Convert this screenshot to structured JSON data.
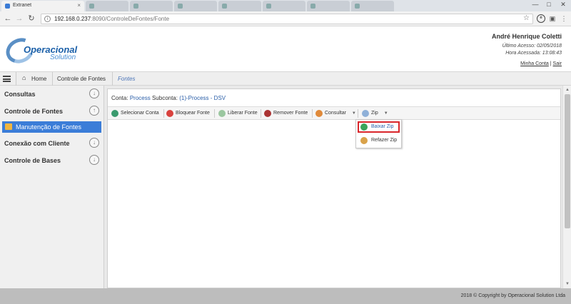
{
  "browser": {
    "active_tab_title": "Extranet",
    "url_host": "192.168.0.237",
    "url_path": ":8090/ControleDeFontes/Fonte",
    "window_controls": [
      "—",
      "□",
      "✕"
    ]
  },
  "header": {
    "logo_main": "Operacional",
    "logo_sub": "Solution",
    "user_name": "André Henrique Coletti",
    "last_access": "Último Acesso: 02/05/2018",
    "access_time": "Hora Acessada: 13:08:43",
    "my_account": "Minha Conta",
    "link_separator": "|",
    "logout": "Sair"
  },
  "breadcrumb": {
    "home": "Home",
    "section": "Controle de Fontes",
    "current": "Fontes"
  },
  "sidebar": {
    "items": [
      {
        "label": "Consultas",
        "toggle": "↓"
      },
      {
        "label": "Controle de Fontes",
        "toggle": "↑"
      },
      {
        "label": "Conexão com Cliente",
        "toggle": "↓"
      },
      {
        "label": "Controle de Bases",
        "toggle": "↓"
      }
    ],
    "sub_item": "Manutenção de Fontes"
  },
  "main": {
    "account_label": "Conta:",
    "account_value": "Process",
    "subaccount_label": "Subconta:",
    "subaccount_value": "(1)-Process - DSV",
    "buttons": {
      "select_account": "Selecionar Conta",
      "block_source": "Bloquear Fonte",
      "release_source": "Liberar Fonte",
      "remove_source": "Remover Fonte",
      "consult": "Consultar",
      "zip": "Zip"
    },
    "zip_menu": {
      "download": "Baixar Zip",
      "redo": "Refazer Zip"
    }
  },
  "footer": {
    "copyright": "2018 © Copyright by Operacional Solution Ltda"
  },
  "colors": {
    "accent_blue": "#3b7dd8",
    "link_blue": "#2a5ea8",
    "highlight_red": "#d9262b"
  }
}
